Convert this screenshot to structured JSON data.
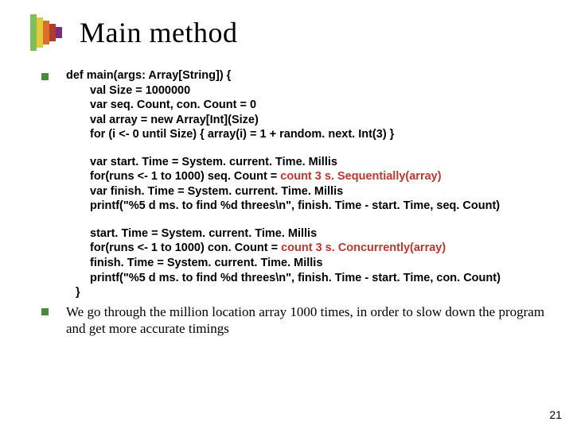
{
  "title": "Main method",
  "code": {
    "l1": "def main(args: Array[String]) {",
    "l2": "val Size = 1000000",
    "l3": "var seq. Count, con. Count = 0",
    "l4": "val array = new Array[Int](Size)",
    "l5": "for (i <- 0 until Size) { array(i) = 1 + random. next. Int(3) }",
    "l6": "var start. Time = System. current. Time. Millis",
    "l7a": "for(runs <- 1 to 1000) seq. Count = ",
    "l7b": "count 3 s. Sequentially(array)",
    "l8": "var finish. Time = System. current. Time. Millis",
    "l9": "printf(\"%5 d ms. to find %d threes\\n\", finish. Time - start. Time, seq. Count)",
    "l10": "start. Time = System. current. Time. Millis",
    "l11a": "for(runs <- 1 to 1000) con. Count = ",
    "l11b": "count 3 s. Concurrently(array)",
    "l12": "finish. Time = System. current. Time. Millis",
    "l13": "printf(\"%5 d ms. to find %d threes\\n\", finish. Time - start. Time, con. Count)",
    "l14": "}"
  },
  "summary": "We go through the million location array 1000 times, in order to slow down the program and get more accurate timings",
  "page_number": "21"
}
